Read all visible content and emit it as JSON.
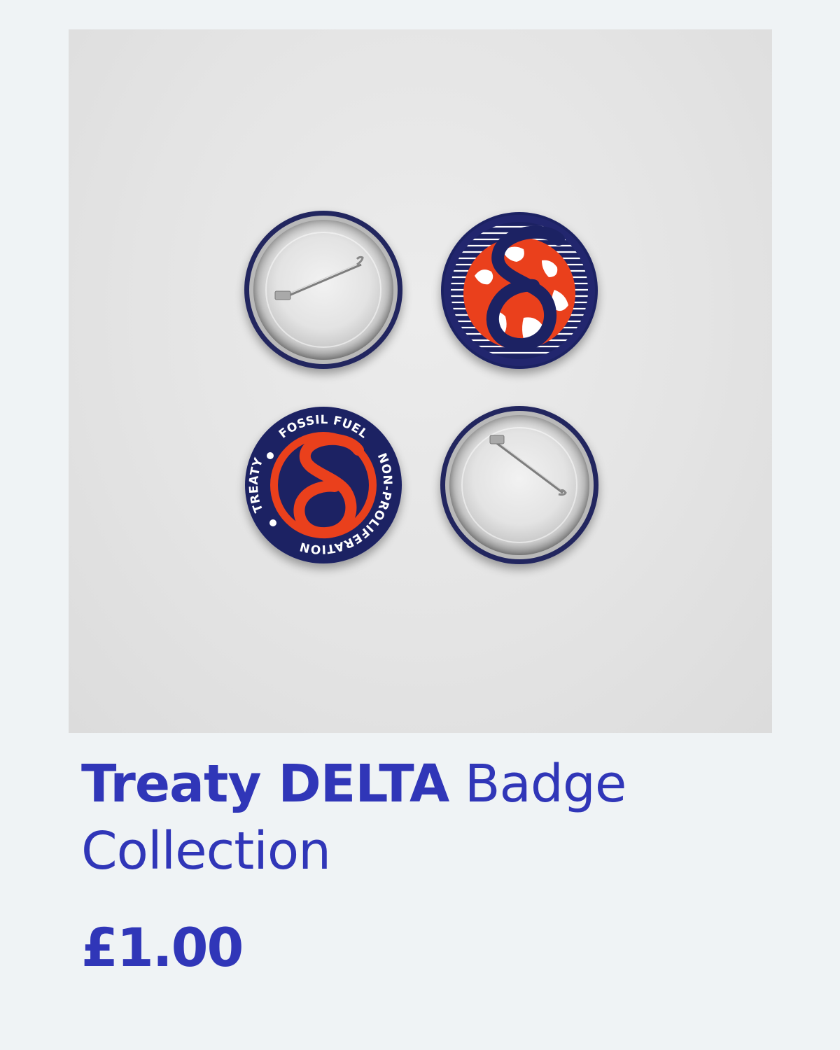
{
  "product": {
    "image": {
      "alt": "Treaty DELTA badge collection",
      "badge_text": {
        "top": "FOSSIL FUEL",
        "right": "NON-PROLIFERATION",
        "left": "TREATY"
      }
    },
    "title": {
      "bold": "Treaty DELTA",
      "rest": "Badge Collection"
    },
    "price": "£1.00"
  },
  "colors": {
    "background": "#eff3f5",
    "accent": "#3036b8",
    "badge_navy": "#1e2264",
    "badge_red": "#ea3f1e"
  }
}
